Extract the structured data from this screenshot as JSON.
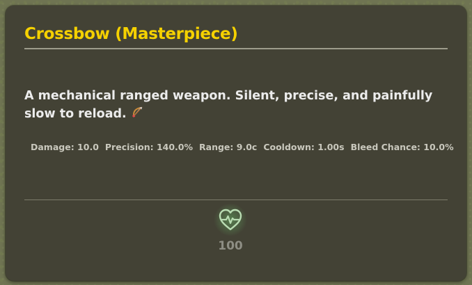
{
  "item": {
    "title": "Crossbow (Masterpiece)",
    "description": "A mechanical ranged weapon. Silent, precise, and painfully slow to reload.",
    "description_icon": "bow-and-arrow-icon"
  },
  "stats": [
    {
      "label": "Damage: 10.0"
    },
    {
      "label": "Precision: 140.0%"
    },
    {
      "label": "Range: 9.0c"
    },
    {
      "label": "Cooldown: 1.00s"
    },
    {
      "label": "Bleed Chance: 10.0%"
    }
  ],
  "health": {
    "icon": "heart-pulse-icon",
    "value": "100"
  },
  "colors": {
    "title": "#f5d100",
    "panel": "#434235",
    "heart": "#9fd39f"
  }
}
